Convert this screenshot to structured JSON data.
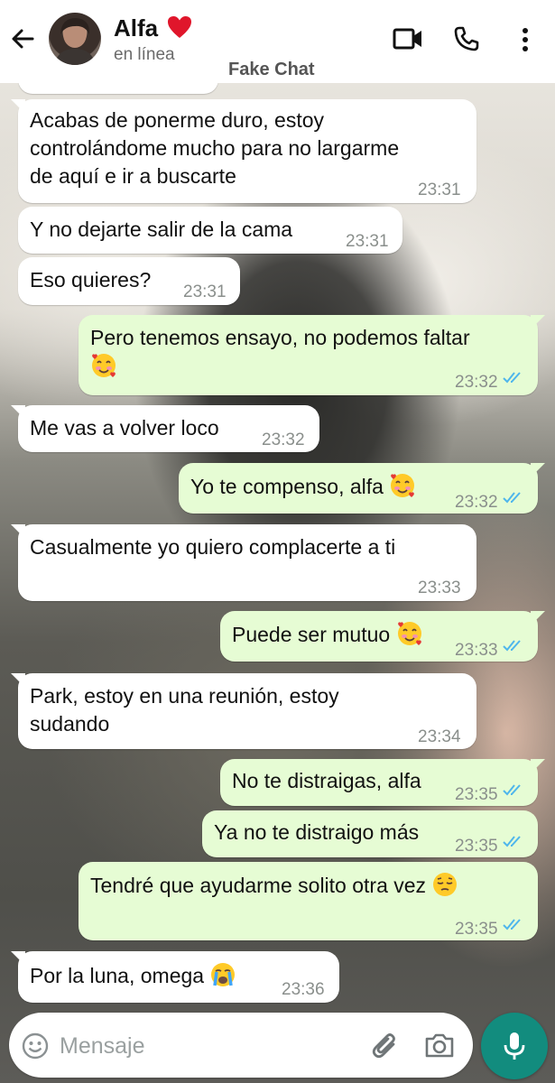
{
  "header": {
    "contact_name": "Alfa",
    "status": "en línea",
    "overlay_label": "Fake Chat",
    "icons": [
      "back-arrow-icon",
      "heart-icon",
      "video-call-icon",
      "phone-icon",
      "more-options-icon"
    ]
  },
  "messages": [
    {
      "from": "them",
      "lines": [
        "Acabas de ponerme duro, estoy",
        "controlándome mucho para no largarme",
        "de aquí e ir a buscarte"
      ],
      "time": "23:31"
    },
    {
      "from": "them",
      "text": "Y no dejarte salir de la cama",
      "time": "23:31"
    },
    {
      "from": "them",
      "text": "Eso quieres?",
      "time": "23:31"
    },
    {
      "from": "me",
      "text": "Pero tenemos ensayo, no podemos faltar",
      "emoji": "smiling-face-with-hearts",
      "time": "23:32",
      "read": true
    },
    {
      "from": "them",
      "text": "Me vas a volver loco",
      "time": "23:32"
    },
    {
      "from": "me",
      "text": "Yo te compenso, alfa",
      "emoji": "smiling-face-with-hearts",
      "time": "23:32",
      "read": true
    },
    {
      "from": "them",
      "text": "Casualmente yo quiero complacerte a ti",
      "time": "23:33"
    },
    {
      "from": "me",
      "text": "Puede ser mutuo",
      "emoji": "smiling-face-with-hearts",
      "time": "23:33",
      "read": true
    },
    {
      "from": "them",
      "lines": [
        "Park, estoy en una reunión, estoy",
        "sudando"
      ],
      "time": "23:34"
    },
    {
      "from": "me",
      "text": "No te distraigas, alfa",
      "time": "23:35",
      "read": true
    },
    {
      "from": "me",
      "text": "Ya no te distraigo más",
      "time": "23:35",
      "read": true
    },
    {
      "from": "me",
      "text": "Tendré que ayudarme solito otra vez",
      "emoji": "pensive-face",
      "time": "23:35",
      "read": true
    },
    {
      "from": "them",
      "text": "Por la luna, omega",
      "emoji": "loudly-crying-face",
      "time": "23:36"
    }
  ],
  "input": {
    "placeholder": "Mensaje"
  },
  "colors": {
    "header_bg": "#ffffff",
    "incoming_bg": "#ffffff",
    "outgoing_bg": "#e6fcd4",
    "mic_button": "#128c7e",
    "read_ticks": "#4fb6ec"
  }
}
